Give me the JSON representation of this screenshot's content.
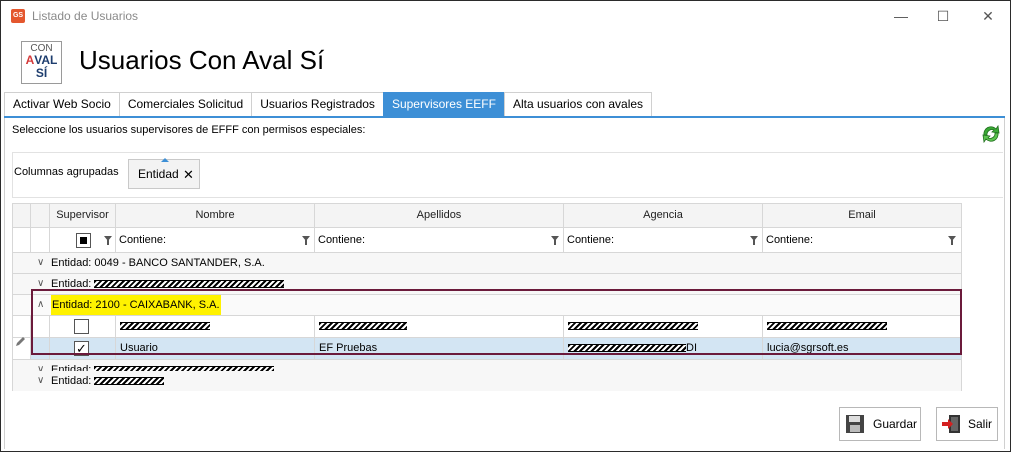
{
  "window": {
    "title": "Listado de Usuarios",
    "icon_text": "GS",
    "minimize": "—",
    "maximize": "☐",
    "close": "✕"
  },
  "header": {
    "logo": {
      "line1": "CON",
      "line2_a": "A",
      "line2_b": "VAL",
      "line3": "SÍ"
    },
    "title": "Usuarios Con Aval Sí"
  },
  "tabs": [
    {
      "label": "Activar Web Socio",
      "active": false
    },
    {
      "label": "Comerciales Solicitud",
      "active": false
    },
    {
      "label": "Usuarios Registrados",
      "active": false
    },
    {
      "label": "Supervisores EEFF",
      "active": true
    },
    {
      "label": "Alta usuarios con avales",
      "active": false
    }
  ],
  "instructions": "Seleccione los usuarios supervisores de EFFF con permisos especiales:",
  "group_panel": {
    "label": "Columnas agrupadas",
    "chip": "Entidad",
    "chip_remove": "✕"
  },
  "grid": {
    "columns": [
      "Supervisor",
      "Nombre",
      "Apellidos",
      "Agencia",
      "Email"
    ],
    "filter_text": "Contiene:",
    "groups": [
      {
        "label": "Entidad: 0049 - BANCO SANTANDER, S.A.",
        "expanded": false,
        "redacted": false,
        "chevron": "∨"
      },
      {
        "label": "Entidad: ",
        "expanded": false,
        "redacted": true,
        "chevron": "∨"
      },
      {
        "label": "Entidad: 2100 - CAIXABANK, S.A.",
        "expanded": true,
        "redacted": false,
        "chevron": "∧"
      },
      {
        "label": "Entidad: ",
        "expanded": false,
        "redacted": true,
        "chevron": "∨"
      },
      {
        "label": "Entidad: ",
        "expanded": false,
        "redacted": true,
        "chevron": "∨"
      }
    ],
    "rows": [
      {
        "supervisor": false,
        "nombre": "",
        "apellidos": "",
        "agencia": "",
        "email": ""
      },
      {
        "supervisor": true,
        "nombre": "Usuario",
        "apellidos": "EF Pruebas",
        "agencia": "DI",
        "email": "lucia@sgrsoft.es"
      }
    ],
    "check_mark": "✓"
  },
  "buttons": {
    "save": "Guardar",
    "exit": "Salir"
  },
  "colors": {
    "accent": "#3d8fd6",
    "highlight": "#fff200",
    "selection": "#d3e5f3",
    "frame": "#6b1a3b"
  }
}
